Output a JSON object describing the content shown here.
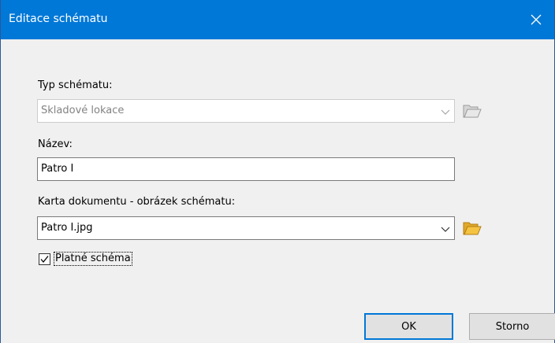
{
  "window": {
    "title": "Editace schématu"
  },
  "form": {
    "schema_type_label": "Typ schématu:",
    "schema_type_value": "Skladové lokace",
    "name_label": "Název:",
    "name_value": "Patro I",
    "document_label": "Karta dokumentu - obrázek schématu:",
    "document_value": "Patro I.jpg",
    "valid_label": "Platné schéma",
    "valid_checked": true
  },
  "buttons": {
    "ok": "OK",
    "cancel": "Storno"
  },
  "icons": {
    "close": "close-icon",
    "chevron": "chevron-down-icon",
    "folder": "folder-open-icon",
    "checkmark": "checkmark-icon"
  },
  "colors": {
    "titlebar": "#0078d7",
    "window_bg": "#f0f0f0",
    "folder": "#f5c342",
    "ok_border": "#0078d7"
  }
}
